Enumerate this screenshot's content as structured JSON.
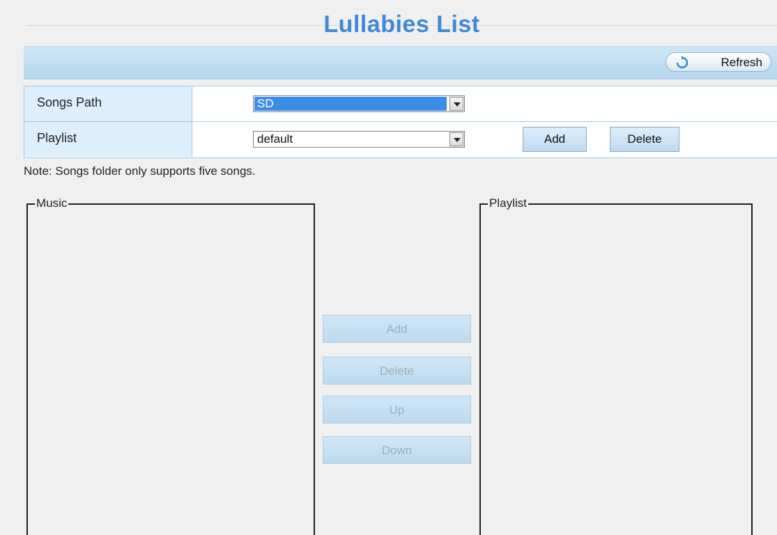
{
  "page": {
    "title": "Lullabies List",
    "refresh_label": "Refresh",
    "note": "Note: Songs folder only supports five songs."
  },
  "settings": {
    "songs_path": {
      "label": "Songs Path",
      "value": "SD"
    },
    "playlist": {
      "label": "Playlist",
      "value": "default",
      "add_label": "Add",
      "delete_label": "Delete"
    }
  },
  "panels": {
    "music_legend": "Music",
    "playlist_legend": "Playlist"
  },
  "transfer_buttons": {
    "add": "Add",
    "delete": "Delete",
    "up": "Up",
    "down": "Down"
  },
  "colors": {
    "title": "#3f88d6",
    "toolbar": "#b4d6ef",
    "selected": "#3b8ee7"
  }
}
